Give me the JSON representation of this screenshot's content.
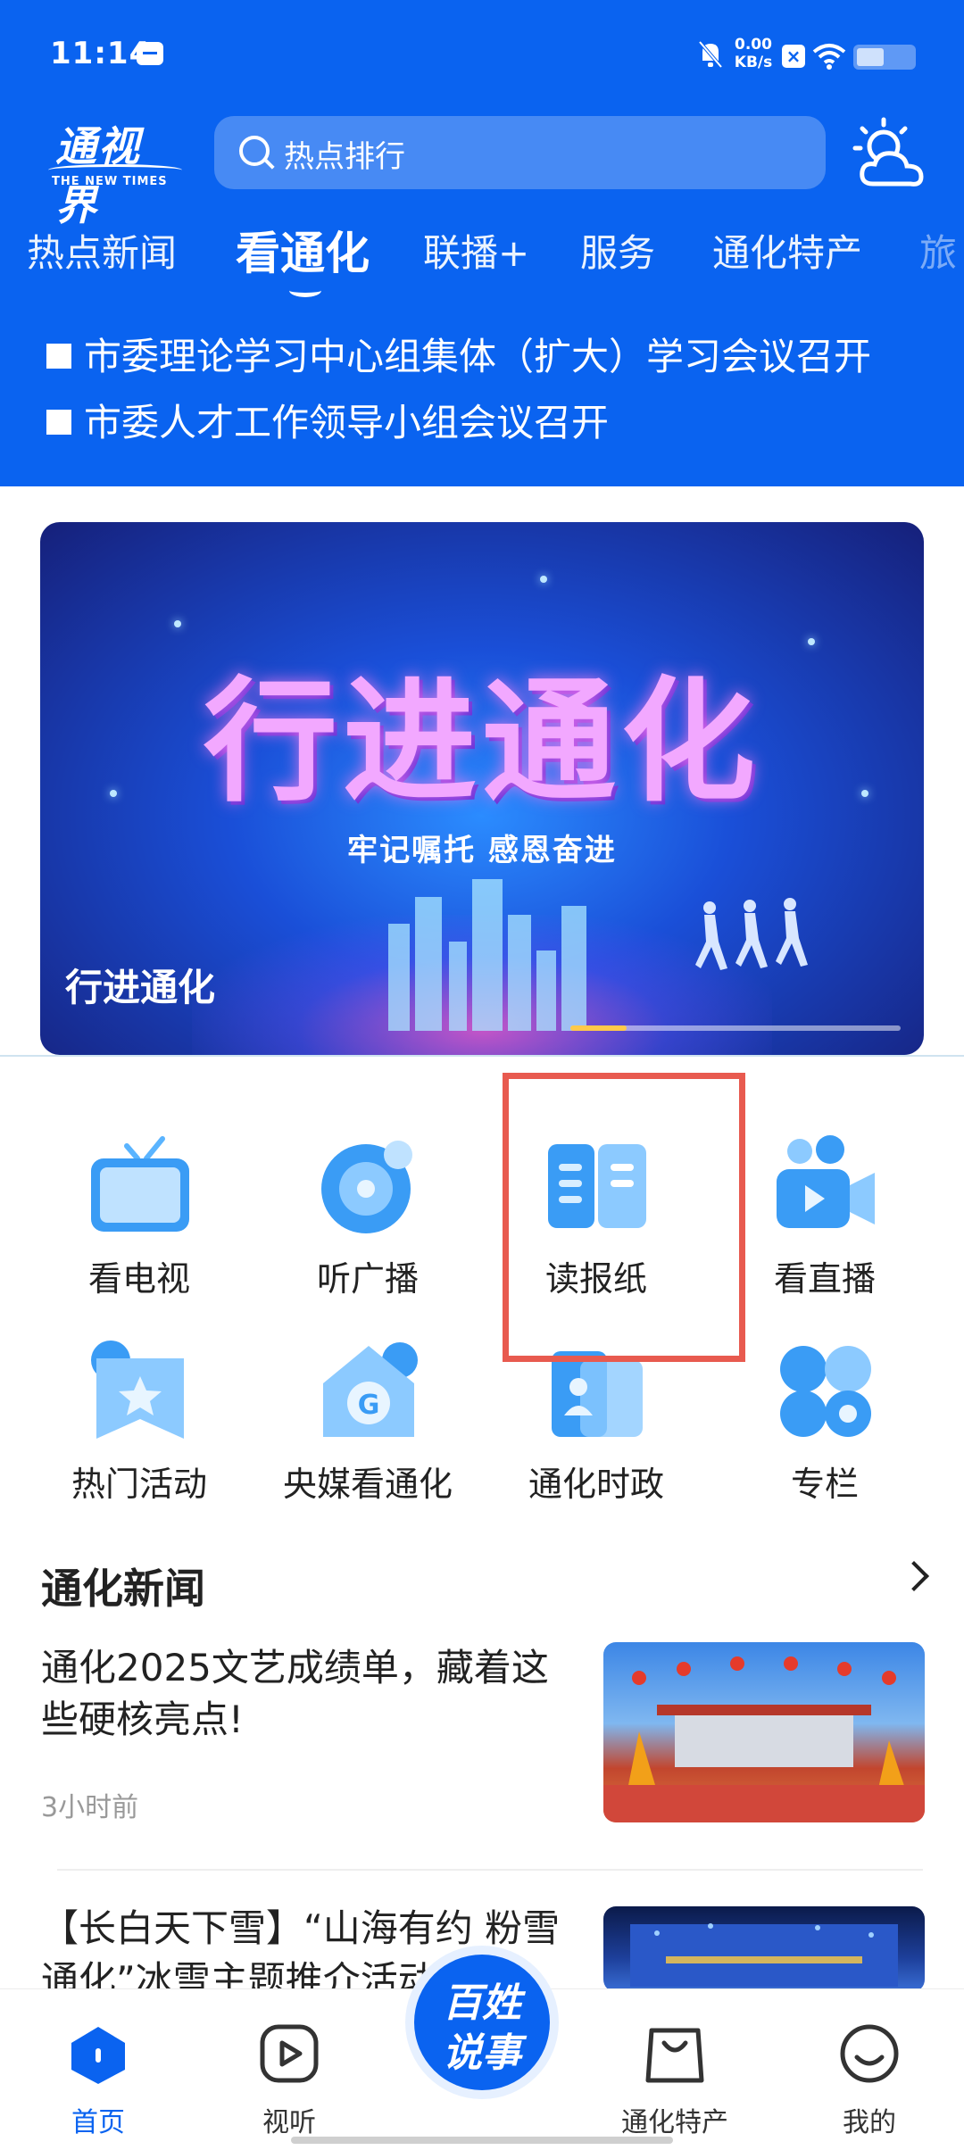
{
  "status_bar": {
    "time": "11:14",
    "speed_value": "0.00",
    "speed_unit": "KB/s"
  },
  "header": {
    "logo_cn": "通视界",
    "logo_en": "THE NEW TIMES",
    "search_placeholder": "热点排行",
    "weather_icon": "weather-cloud-sun-icon"
  },
  "tabs": [
    {
      "label": "热点新闻",
      "active": false
    },
    {
      "label": "看通化",
      "active": true
    },
    {
      "label": "联播+",
      "active": false
    },
    {
      "label": "服务",
      "active": false
    },
    {
      "label": "通化特产",
      "active": false
    },
    {
      "label": "旅",
      "active": false
    }
  ],
  "headlines": [
    "市委理论学习中心组集体（扩大）学习会议召开",
    "市委人才工作领导小组会议召开"
  ],
  "banner": {
    "title_art": "行进通化",
    "slogan": "牢记嘱托 感恩奋进",
    "caption": "行进通化",
    "progress": 0.17
  },
  "grid": [
    {
      "label": "看电视",
      "icon": "tv-icon"
    },
    {
      "label": "听广播",
      "icon": "radio-disc-icon"
    },
    {
      "label": "读报纸",
      "icon": "newspaper-icon",
      "highlighted": true
    },
    {
      "label": "看直播",
      "icon": "video-camera-icon"
    },
    {
      "label": "热门活动",
      "icon": "star-bookmark-icon"
    },
    {
      "label": "央媒看通化",
      "icon": "media-house-icon"
    },
    {
      "label": "通化时政",
      "icon": "profile-card-icon"
    },
    {
      "label": "专栏",
      "icon": "four-dots-icon"
    }
  ],
  "news_section": {
    "title": "通化新闻",
    "items": [
      {
        "title": "通化2025文艺成绩单，藏着这些硬核亮点!",
        "time": "3小时前"
      },
      {
        "title": "【长白天下雪】“山海有约 粉雪通化”冰雪主题推介活动…",
        "time": ""
      }
    ]
  },
  "bottom_nav": [
    {
      "label": "首页",
      "icon": "home-icon",
      "active": true
    },
    {
      "label": "视听",
      "icon": "play-icon",
      "active": false
    },
    {
      "label": "通化特产",
      "icon": "shopping-bag-icon",
      "active": false
    },
    {
      "label": "我的",
      "icon": "smile-face-icon",
      "active": false
    }
  ],
  "center_button": {
    "line1": "百姓",
    "line2": "说事"
  },
  "colors": {
    "brand_blue": "#0a63f0",
    "highlight_red": "#e85a4f",
    "icon_blue": "#3a9cf5"
  }
}
